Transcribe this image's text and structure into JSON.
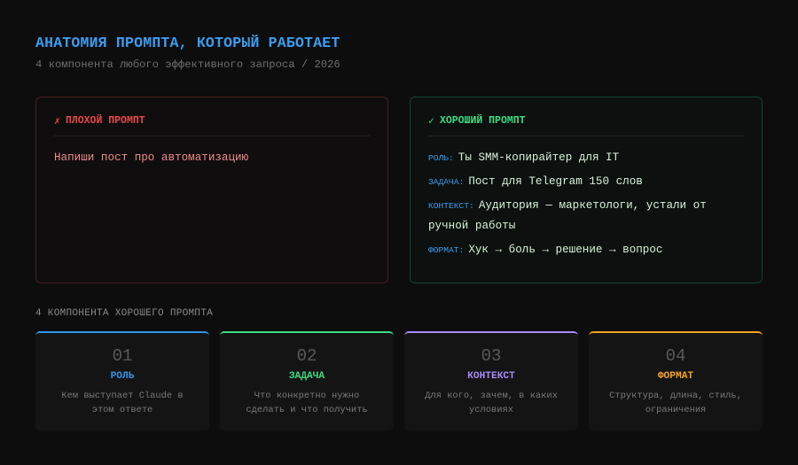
{
  "header": {
    "title": "АНАТОМИЯ ПРОМПТА, КОТОРЫЙ РАБОТАЕТ",
    "subtitle": "4 компонента любого эффективного запроса / 2026"
  },
  "bad_prompt": {
    "icon": "cross-icon",
    "mark": "✗",
    "title": "ПЛОХОЙ ПРОМПТ",
    "text": "Напиши пост про автоматизацию"
  },
  "good_prompt": {
    "icon": "check-icon",
    "mark": "✓",
    "title": "ХОРОШИЙ ПРОМПТ",
    "rows": [
      {
        "key": "РОЛЬ:",
        "value": "Ты SMM-копирайтер для IT"
      },
      {
        "key": "ЗАДАЧА:",
        "value": "Пост для Telegram 150 слов"
      },
      {
        "key": "КОНТЕКСТ:",
        "value": "Аудитория — маркетологи, устали от ручной работы"
      },
      {
        "key": "ФОРМАТ:",
        "value": "Хук → боль → решение → вопрос"
      }
    ]
  },
  "components": {
    "label": "4 КОМПОНЕНТА ХОРОШЕГО ПРОМПТА",
    "cards": [
      {
        "num": "01",
        "name": "РОЛЬ",
        "desc": "Кем выступает Claude в этом ответе",
        "color": "#2f95e8"
      },
      {
        "num": "02",
        "name": "ЗАДАЧА",
        "desc": "Что конкретно нужно сделать и что получить",
        "color": "#3ddc84"
      },
      {
        "num": "03",
        "name": "КОНТЕКСТ",
        "desc": "Для кого, зачем, в каких условиях",
        "color": "#a78bfa"
      },
      {
        "num": "04",
        "name": "ФОРМАТ",
        "desc": "Структура, длина, стиль, ограничения",
        "color": "#f5a524"
      }
    ]
  }
}
